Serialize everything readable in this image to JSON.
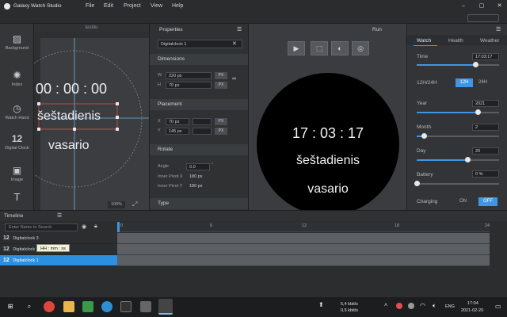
{
  "window": {
    "title": "Galaxy Watch Studio"
  },
  "menu": [
    "File",
    "Edit",
    "Project",
    "View",
    "Help"
  ],
  "toolbox": {
    "items": [
      {
        "label": "Background",
        "icon": "background-icon"
      },
      {
        "label": "Index",
        "icon": "index-icon"
      },
      {
        "label": "Watch Hand",
        "icon": "watch-hand-icon"
      },
      {
        "label": "Digital Clock",
        "icon": "digital-clock-icon"
      },
      {
        "label": "Image",
        "icon": "image-icon"
      }
    ],
    "digital_clock_glyph": "12",
    "text_tool_glyph": "T"
  },
  "canvas": {
    "tab": "testitu",
    "time": "00 : 00 : 00",
    "day": "šeštadienis",
    "month": "vasario",
    "zoom": "100%"
  },
  "properties": {
    "title": "Properties",
    "name": "Digitalclock 1",
    "dimensions": {
      "label": "Dimensions",
      "w_label": "W",
      "w": "220 px",
      "h_label": "H",
      "h": "70 px",
      "unit": "PX"
    },
    "placement": {
      "label": "Placement",
      "x_label": "X",
      "x": "70 px",
      "y_label": "Y",
      "y": "145 px",
      "unit": "PX"
    },
    "rotate": {
      "label": "Rotate",
      "angle_label": "Angle",
      "angle": "0.0",
      "angle_unit": "°",
      "pivot_x_label": "Inner Pivot X",
      "pivot_x": "180 px",
      "pivot_y_label": "Inner Pivot Y",
      "pivot_y": "180 px"
    },
    "type": {
      "label": "Type"
    }
  },
  "run": {
    "title": "Run",
    "time": "17 : 03 : 17",
    "day": "šeštadienis",
    "month": "vasario"
  },
  "watch_panel": {
    "tabs": [
      "Watch",
      "Health",
      "Weather"
    ],
    "time_label": "Time",
    "time": "17:03:17",
    "time_fraction": 0.71,
    "hour_format_label": "12H/24H",
    "opt_12h": "12H",
    "opt_24h": "24H",
    "year_label": "Year",
    "year": "2021",
    "year_fraction": 0.74,
    "month_label": "Month",
    "month": "2",
    "month_fraction": 0.09,
    "day_label": "Day",
    "day": "20",
    "day_fraction": 0.62,
    "battery_label": "Battery",
    "battery": "0 %",
    "battery_fraction": 0.0,
    "charging_label": "Charging",
    "on": "ON",
    "off": "OFF"
  },
  "timeline": {
    "title": "Timeline",
    "search_placeholder": "Enter Name to Search",
    "layers": [
      "Digitalclock 3",
      "Digitalclock 2",
      "Digitalclock 1"
    ],
    "layer_glyph": "12",
    "tooltip": "HH : mm : ss",
    "ruler": [
      "0",
      "6",
      "12",
      "18",
      "24"
    ]
  },
  "taskbar": {
    "net_up": "5,4 kbit/s",
    "net_down": "0,5 kbit/s",
    "lang": "ENG",
    "time": "17:04",
    "date": "2021-02-20"
  },
  "colors": {
    "accent": "#3d97e6",
    "selected_layer": "#2d8fe0"
  }
}
